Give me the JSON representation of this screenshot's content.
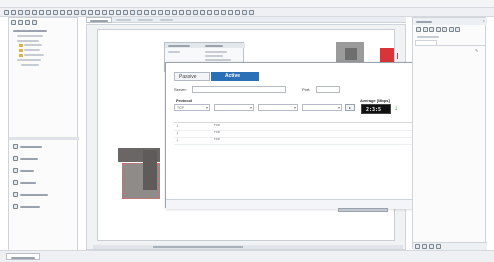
{
  "menubar": {
    "items": [
      "",
      "",
      "",
      "",
      "",
      "",
      "",
      "",
      "",
      "",
      "",
      ""
    ]
  },
  "tool_dialog": {
    "modes": [
      "Passive",
      "Active"
    ],
    "server_label": "Server:",
    "server_value": "",
    "port_label": "Port:",
    "port_value": "",
    "col_protocol": "Protocol",
    "col_direction": "",
    "col_packet_size": "",
    "col_period": "",
    "protocol_value": "TCP",
    "direction_value": "",
    "packet_size_value": "",
    "period_value": "",
    "average_label": "Average [Mbps]",
    "average_value": "2:3:5",
    "table_headers": [
      "",
      "",
      "",
      "",
      "",
      "",
      "",
      ""
    ],
    "rows": [
      {
        "time": "",
        "protocol": "TCP",
        "size": "",
        "duration": "",
        "server": "",
        "received": "",
        "lost": "",
        "mbps": ""
      },
      {
        "time": "",
        "protocol": "TCP",
        "size": "",
        "duration": "",
        "server": "",
        "received": "",
        "lost": "",
        "mbps": ""
      },
      {
        "time": "",
        "protocol": "TCP",
        "size": "",
        "duration": "",
        "server": "",
        "received": "",
        "lost": "",
        "mbps": ""
      }
    ],
    "status_left": "",
    "status_mid": "",
    "status_right": "",
    "status_extra": "",
    "status_page": ""
  },
  "colors": {
    "accent": "#2b6fb7",
    "active_tab": "#2b6fb7",
    "arrow": "#2e9a3b",
    "logo": "#d8343a"
  }
}
